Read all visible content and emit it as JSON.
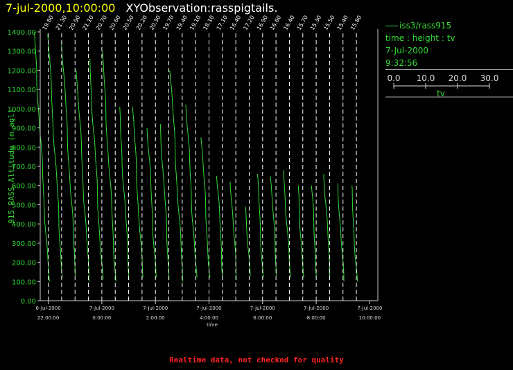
{
  "header": {
    "datetime": "7-jul-2000,10:00:00",
    "title": "XYObservation:rasspigtails."
  },
  "legend": {
    "series_label": "iss3/rass915",
    "line1": "time : height : tv",
    "line2": "7-Jul-2000",
    "line3": "9:32:56",
    "scale_ticks": [
      "0.0",
      "10.0",
      "20.0",
      "30.0"
    ],
    "scale_label": "tv"
  },
  "footer": {
    "warning": "Realtime data, not checked for quality"
  },
  "colors": {
    "trace": "#33dd33",
    "axis": "#cccccc",
    "title_date": "#ffff00",
    "warning": "#ff2222"
  },
  "chart_data": {
    "type": "line",
    "ylabel": "915 RASS Altitude (m agl)",
    "xlabel": "time",
    "ylim": [
      0,
      1400
    ],
    "yticks": [
      "0.00",
      "100.00",
      "200.00",
      "300.00",
      "400.00",
      "500.00",
      "600.00",
      "700.00",
      "800.00",
      "900.00",
      "1000.00",
      "1100.00",
      "1200.00",
      "1300.00",
      "1400.00"
    ],
    "xlim": [
      -2.3,
      10.3
    ],
    "xticks": [
      {
        "x": -2,
        "date": "6-Jul-2000",
        "time": "22:00:00"
      },
      {
        "x": 0,
        "date": "7-Jul-2000",
        "time": "0:00:00"
      },
      {
        "x": 2,
        "date": "7-Jul-2000",
        "time": "2:00:00"
      },
      {
        "x": 4,
        "date": "7-Jul-2000",
        "time": "4:00:00"
      },
      {
        "x": 6,
        "date": "7-Jul-2000",
        "time": "6:00:00"
      },
      {
        "x": 8,
        "date": "7-Jul-2000",
        "time": "8:00:00"
      },
      {
        "x": 10,
        "date": "7-Jul-2000",
        "time": "10:00:00"
      }
    ],
    "x_units": "hours relative to 7-Jul-2000 0:00",
    "tv_scale_hours_per_degC": 0.05,
    "profiles": [
      {
        "t": -2.0,
        "label": "19.80",
        "low": 100,
        "high": 1400
      },
      {
        "t": -1.5,
        "label": "21.30",
        "low": 120,
        "high": 1390
      },
      {
        "t": -1.0,
        "label": "20.90",
        "low": 130,
        "high": 1350
      },
      {
        "t": -0.5,
        "label": "21.10",
        "low": 100,
        "high": 1200
      },
      {
        "t": 0.0,
        "label": "20.70",
        "low": 110,
        "high": 1260
      },
      {
        "t": 0.5,
        "label": "20.60",
        "low": 100,
        "high": 1300
      },
      {
        "t": 1.0,
        "label": "20.50",
        "low": 110,
        "high": 1010
      },
      {
        "t": 1.5,
        "label": "20.20",
        "low": 120,
        "high": 1010
      },
      {
        "t": 2.0,
        "label": "20.30",
        "low": 120,
        "high": 900
      },
      {
        "t": 2.5,
        "label": "19.70",
        "low": 110,
        "high": 920
      },
      {
        "t": 3.0,
        "label": "19.40",
        "low": 100,
        "high": 1200
      },
      {
        "t": 3.5,
        "label": "19.10",
        "low": 120,
        "high": 1020
      },
      {
        "t": 4.0,
        "label": "18.10",
        "low": 120,
        "high": 850
      },
      {
        "t": 4.5,
        "label": "17.10",
        "low": 110,
        "high": 650
      },
      {
        "t": 5.0,
        "label": "16.40",
        "low": 110,
        "high": 620
      },
      {
        "t": 5.5,
        "label": "17.20",
        "low": 130,
        "high": 490
      },
      {
        "t": 6.0,
        "label": "16.90",
        "low": 120,
        "high": 660
      },
      {
        "t": 6.5,
        "label": "16.60",
        "low": 130,
        "high": 650
      },
      {
        "t": 7.0,
        "label": "16.40",
        "low": 120,
        "high": 680
      },
      {
        "t": 7.5,
        "label": "15.70",
        "low": 120,
        "high": 600
      },
      {
        "t": 8.0,
        "label": "15.30",
        "low": 120,
        "high": 600
      },
      {
        "t": 8.5,
        "label": "15.50",
        "low": 110,
        "high": 660
      },
      {
        "t": 9.0,
        "label": "15.40",
        "low": 100,
        "high": 610
      },
      {
        "t": 9.5,
        "label": "15.80",
        "low": 100,
        "high": 600
      }
    ],
    "grid": false,
    "legend_placement": "right"
  }
}
